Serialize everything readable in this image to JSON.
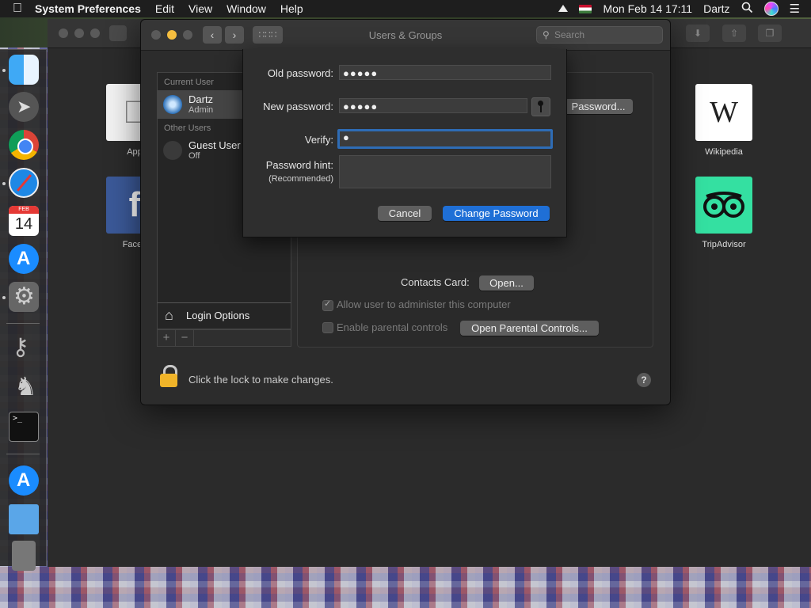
{
  "menubar": {
    "app_name": "System Preferences",
    "menus": [
      "Edit",
      "View",
      "Window",
      "Help"
    ],
    "datetime": "Mon Feb 14  17:11",
    "user": "Dartz"
  },
  "background_window": {
    "favorites": [
      {
        "label": "App"
      },
      {
        "label": "Faceb"
      },
      {
        "label": "Wikipedia",
        "glyph": "W"
      },
      {
        "label": "TripAdvisor"
      }
    ]
  },
  "dock": {
    "calendar_month": "FEB",
    "calendar_day": "14",
    "terminal_prompt": ">_"
  },
  "window": {
    "title": "Users & Groups",
    "search_placeholder": "Search"
  },
  "users": {
    "current_header": "Current User",
    "current_user": {
      "name": "Dartz",
      "role": "Admin"
    },
    "other_header": "Other Users",
    "guest": {
      "name": "Guest User",
      "status": "Off"
    },
    "login_options": "Login Options",
    "add": "+",
    "remove": "−"
  },
  "pane": {
    "change_password_button": "Password...",
    "contacts_card_label": "Contacts Card:",
    "open_button": "Open...",
    "allow_admin_label": "Allow user to administer this computer",
    "allow_admin_checked": true,
    "parental_label": "Enable parental controls",
    "parental_checked": false,
    "open_parental_button": "Open Parental Controls..."
  },
  "lock": {
    "text": "Click the lock to make changes."
  },
  "help": "?",
  "sheet": {
    "old_password_label": "Old password:",
    "old_password_value": "●●●●●",
    "new_password_label": "New password:",
    "new_password_value": "●●●●●",
    "verify_label": "Verify:",
    "verify_value": "●",
    "hint_label": "Password hint:",
    "hint_sub": "(Recommended)",
    "hint_value": "",
    "cancel": "Cancel",
    "change": "Change Password"
  },
  "colors": {
    "accent": "#1f6fd6",
    "focus_ring": "#2e6cb5",
    "lock": "#f0b429"
  }
}
